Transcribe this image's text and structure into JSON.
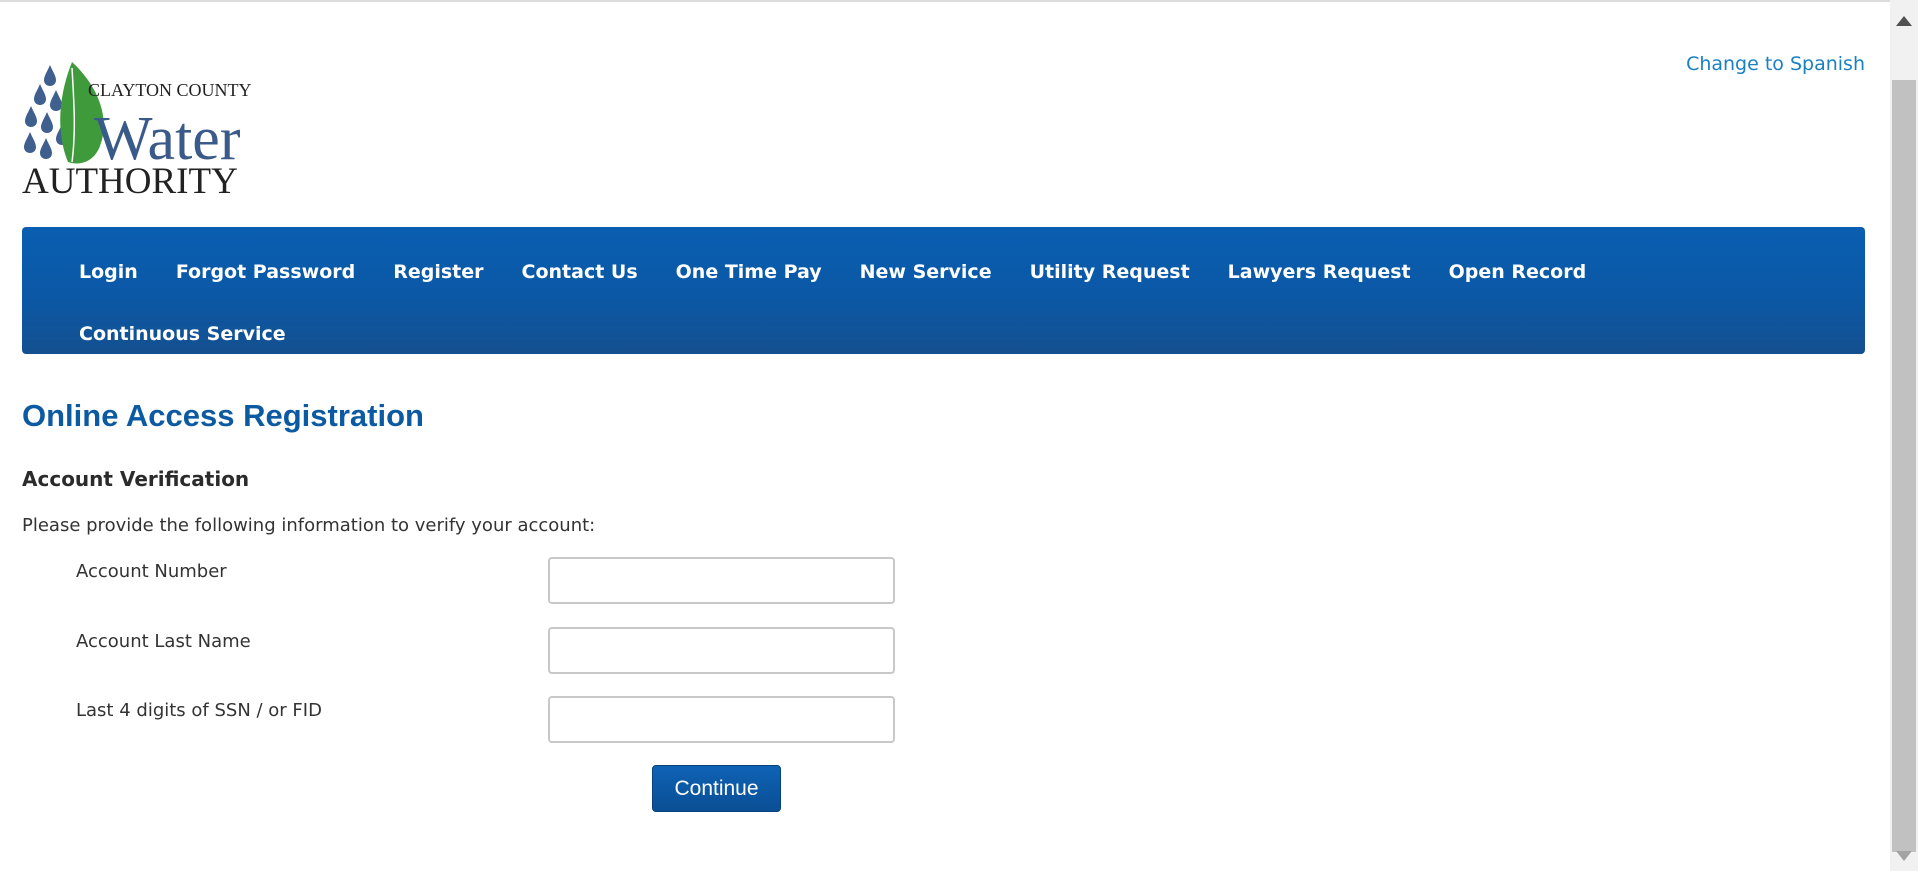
{
  "header": {
    "logo": {
      "line1": "CLAYTON COUNTY",
      "line2": "Water",
      "line3": "AUTHORITY",
      "icon": "leaf-water-drops-logo",
      "colors": {
        "drops": "#3f5f8f",
        "leaf": "#3f9a3c",
        "water_text": "#3a5a8a",
        "authority_text": "#222222"
      }
    },
    "language_link": "Change to Spanish"
  },
  "nav": {
    "items": [
      {
        "label": "Login"
      },
      {
        "label": "Forgot Password"
      },
      {
        "label": "Register"
      },
      {
        "label": "Contact Us"
      },
      {
        "label": "One Time Pay"
      },
      {
        "label": "New Service"
      },
      {
        "label": "Utility Request"
      },
      {
        "label": "Lawyers Request"
      },
      {
        "label": "Open Record"
      },
      {
        "label": "Continuous Service"
      }
    ],
    "background": "#0b58a6"
  },
  "main": {
    "title": "Online Access Registration",
    "section_title": "Account Verification",
    "intro": "Please provide the following information to verify your account:",
    "fields": [
      {
        "label": "Account Number",
        "value": ""
      },
      {
        "label": "Account Last Name",
        "value": ""
      },
      {
        "label": "Last 4 digits of SSN / or FID",
        "value": ""
      }
    ],
    "continue_label": "Continue"
  },
  "colors": {
    "accent": "#0c5aa2",
    "link": "#1a80c4"
  }
}
